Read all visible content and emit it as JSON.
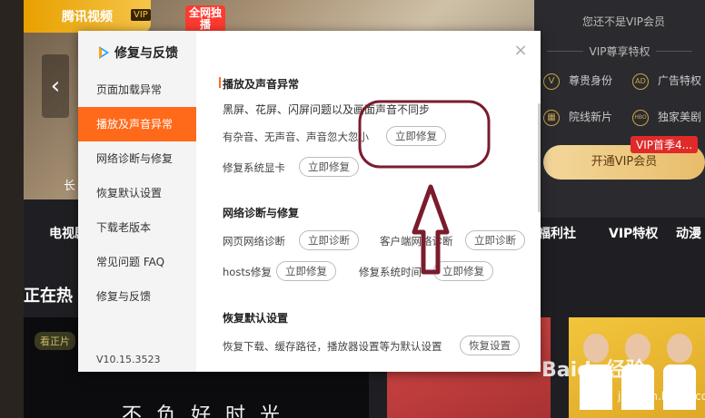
{
  "background": {
    "banner": {
      "logo_text": "腾讯视频",
      "vip_tag": "VIP",
      "badge_text": "全网独播",
      "caption": "长",
      "prev_arrow": "‹"
    },
    "right_panel": {
      "not_vip_text": "您还不是VIP会员",
      "privilege_title": "VIP尊享特权",
      "privileges": [
        {
          "icon": "crown-icon",
          "glyph": "V",
          "label": "尊贵身份"
        },
        {
          "icon": "no-ads-icon",
          "glyph": "AD",
          "label": "广告特权"
        },
        {
          "icon": "film-icon",
          "glyph": "▦",
          "label": "院线新片"
        },
        {
          "icon": "hbo-icon",
          "glyph": "HBO",
          "label": "独家美剧"
        }
      ],
      "promo_text": "VIP首季4...",
      "open_vip_label": "开通VIP会员"
    },
    "nav": [
      "电视剧",
      "福利社",
      "VIP特权",
      "动漫"
    ],
    "hot_title": "正在热",
    "tile_tag": "看正片",
    "tile_big_text": "不负好时光",
    "watermark": "Baidu经验",
    "watermark_sub": "jingyan.baidu.com"
  },
  "dialog": {
    "title": "修复与反馈",
    "close_glyph": "×",
    "version": "V10.15.3523",
    "nav_items": [
      {
        "label": "页面加载异常",
        "active": false
      },
      {
        "label": "播放及声音异常",
        "active": true
      },
      {
        "label": "网络诊断与修复",
        "active": false
      },
      {
        "label": "恢复默认设置",
        "active": false
      },
      {
        "label": "下载老版本",
        "active": false
      },
      {
        "label": "常见问题 FAQ",
        "active": false
      },
      {
        "label": "修复与反馈",
        "active": false
      }
    ],
    "sections": {
      "playback": {
        "title": "播放及声音异常",
        "line1": "黑屏、花屏、闪屏问题以及画面声音不同步",
        "line2": "有杂音、无声音、声音忽大忽小",
        "line2_button": "立即修复",
        "line3": "修复系统显卡",
        "line3_button": "立即修复"
      },
      "network": {
        "title": "网络诊断与修复",
        "web_label": "网页网络诊断",
        "web_button": "立即诊断",
        "client_label": "客户端网络诊断",
        "client_button": "立即诊断",
        "hosts_label": "hosts修复",
        "hosts_button": "立即修复",
        "systime_label": "修复系统时间",
        "systime_button": "立即修复"
      },
      "reset": {
        "title": "恢复默认设置",
        "text": "恢复下载、缓存路径，播放器设置等为默认设置",
        "button": "恢复设置"
      }
    }
  },
  "colors": {
    "accent": "#ff6a1a",
    "annotation": "#7a1c2c",
    "vip_gold": "#e8bd6a"
  }
}
